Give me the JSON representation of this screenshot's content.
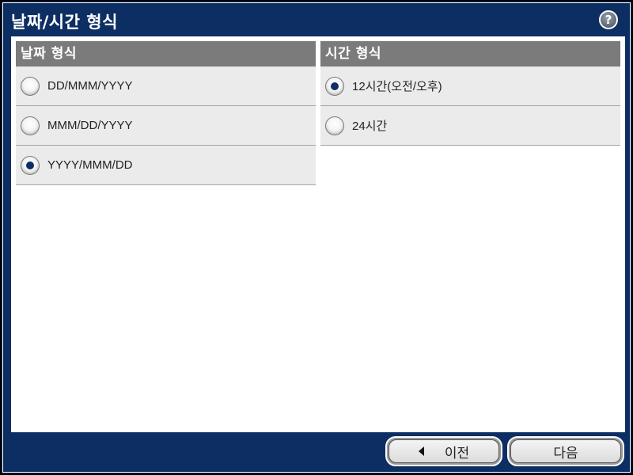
{
  "window": {
    "title": "날짜/시간 형식",
    "help_label": "?"
  },
  "date_format": {
    "header": "날짜 형식",
    "options": [
      {
        "label": "DD/MMM/YYYY",
        "selected": false
      },
      {
        "label": "MMM/DD/YYYY",
        "selected": false
      },
      {
        "label": "YYYY/MMM/DD",
        "selected": true
      }
    ]
  },
  "time_format": {
    "header": "시간 형식",
    "options": [
      {
        "label": "12시간(오전/오후)",
        "selected": true
      },
      {
        "label": "24시간",
        "selected": false
      }
    ]
  },
  "footer": {
    "prev_label": "이전",
    "next_label": "다음"
  },
  "colors": {
    "frame": "#0c2e63",
    "header_bg": "#7b7b7b",
    "option_bg": "#ebebeb",
    "radio_dot": "#0c2e63"
  }
}
